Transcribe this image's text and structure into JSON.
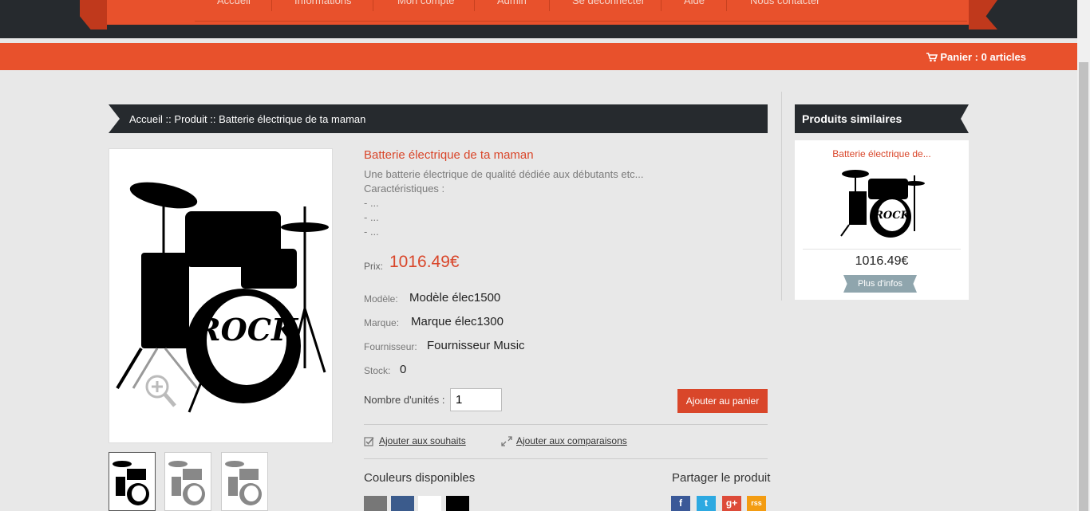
{
  "nav": {
    "items": [
      "Accueil",
      "Informations",
      "Mon compte",
      "Admin",
      "Se déconnecter",
      "Aide",
      "Nous contacter"
    ]
  },
  "cart": {
    "label": "Panier : 0 articles"
  },
  "breadcrumb": {
    "home": "Accueil",
    "sep": "::",
    "category": "Produit",
    "current": "Batterie électrique de ta maman"
  },
  "product": {
    "title": "Batterie électrique de ta maman",
    "description": "Une batterie électrique de qualité dédiée aux débutants etc...\nCaractéristiques :\n- ...\n- ...\n- ...",
    "price_label": "Prix:",
    "price": "1016.49€",
    "image_text": "ROCK",
    "attributes": [
      {
        "label": "Modèle:",
        "value": "Modèle élec1500"
      },
      {
        "label": "Marque:",
        "value": "Marque élec1300"
      },
      {
        "label": "Fournisseur:",
        "value": "Fournisseur Music"
      },
      {
        "label": "Stock:",
        "value": "0"
      }
    ],
    "qty_label": "Nombre d'unités :",
    "qty_value": "1",
    "add_to_cart": "Ajouter au panier",
    "wishlist": "Ajouter aux souhaits",
    "compare": "Ajouter aux comparaisons",
    "colors_title": "Couleurs disponibles",
    "colors": [
      "#777777",
      "#3b5b8c",
      "#ffffff",
      "#000000"
    ],
    "share_title": "Partager le produit",
    "share": [
      {
        "name": "facebook",
        "glyph": "f",
        "color": "#3b5998"
      },
      {
        "name": "twitter",
        "glyph": "t",
        "color": "#2da9e1"
      },
      {
        "name": "google-plus",
        "glyph": "g+",
        "color": "#dd4b39"
      },
      {
        "name": "rss",
        "glyph": "rss",
        "color": "#f39c12"
      }
    ]
  },
  "similar": {
    "title": "Produits similaires",
    "item_name": "Batterie électrique de...",
    "item_price": "1016.49€",
    "more": "Plus d'infos"
  }
}
